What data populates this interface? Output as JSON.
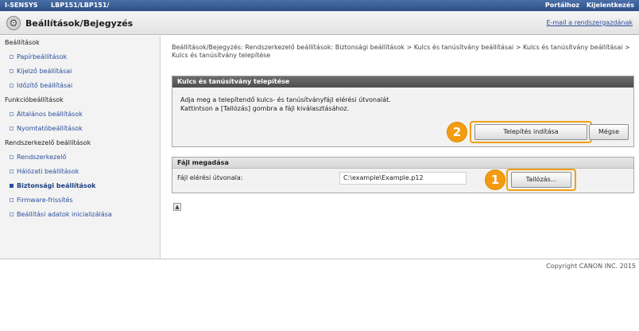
{
  "topbar": {
    "brand": "I-SENSYS",
    "model": "LBP151/LBP151/",
    "portal_link": "Portálhoz",
    "logout_link": "Kijelentkezés"
  },
  "header": {
    "title": "Beállítások/Bejegyzés",
    "mail_link": "E-mail a rendszergazdának",
    "gear_icon": "gear-icon"
  },
  "sidebar": {
    "groups": [
      {
        "title": "Beállítások",
        "items": [
          "Papírbeállítások",
          "Kijelző beállításai",
          "Időzítő beállításai"
        ]
      },
      {
        "title": "Funkcióbeállítások",
        "items": [
          "Általános beállítások",
          "Nyomtatóbeállítások"
        ]
      },
      {
        "title": "Rendszerkezelő beállítások",
        "items": [
          "Rendszerkezelő",
          "Hálózati beállítások",
          "Biztonsági beállítások",
          "Firmware-frissítés",
          "Beállítási adatok inicializálása"
        ]
      }
    ],
    "active_item": "Biztonsági beállítások"
  },
  "main": {
    "breadcrumb": "Beállítások/Bejegyzés: Rendszerkezelő beállítások: Biztonsági beállítások > Kulcs és tanúsítvány beállításai > Kulcs és tanúsítvány beállításai > Kulcs és tanúsítvány telepítése",
    "install_panel": {
      "header": "Kulcs és tanúsítvány telepítése",
      "instruction_1": "Adja meg a telepítendő kulcs- és tanúsítványfájl elérési útvonalát.",
      "instruction_2": "Kattintson a [Tallózás] gombra a fájl kiválasztásához.",
      "install_button": "Telepítés indítása",
      "cancel_button": "Mégse",
      "callout_install": "2"
    },
    "file_panel": {
      "header": "Fájl megadása",
      "path_label": "Fájl elérési útvonala:",
      "path_value": "C:\\example\\Example.p12",
      "browse_button": "Tallózás...",
      "callout_browse": "1"
    },
    "pager_icon": "page-top-icon"
  },
  "footer": {
    "copyright": "Copyright CANON INC. 2015"
  },
  "colors": {
    "topbar": "#2c4f86",
    "highlight": "#f0a014",
    "callout": "#f39c12",
    "link": "#2a4f9c"
  }
}
